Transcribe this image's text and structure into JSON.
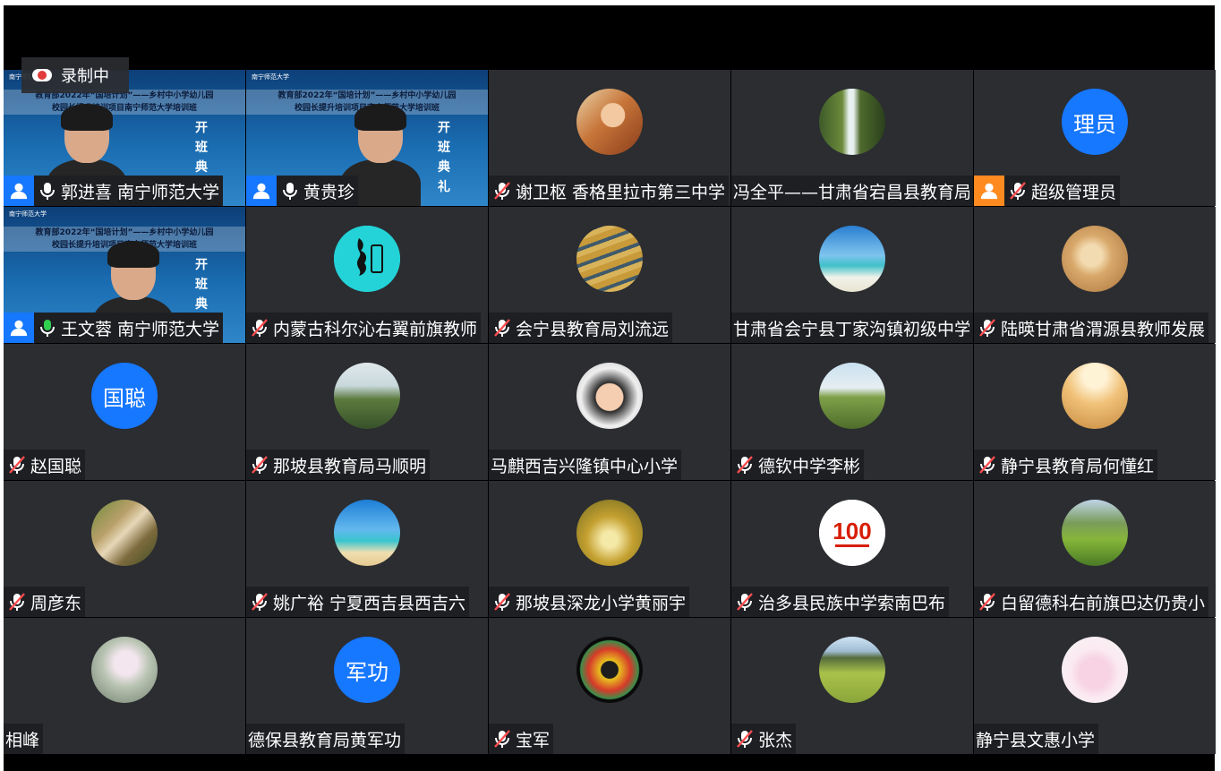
{
  "recording": {
    "label": "录制中"
  },
  "colors": {
    "tile_bg": "#2b2d31",
    "badge_blue": "#1677ff",
    "badge_orange": "#ff8a1f",
    "active_border": "#2fd14f"
  },
  "shared_screen": {
    "university": "南宁师范大学",
    "banner_line1": "教育部2022年“国培计划”——乡村中小学幼儿园",
    "banner_line2": "校园长提升培训项目南宁师范大学培训班",
    "side_text": "开班典礼"
  },
  "participants": [
    {
      "name": "郭进喜 南宁师范大学",
      "avatar_type": "video",
      "avatar_desc": "person-video",
      "badge": "blue",
      "mic": "on"
    },
    {
      "name": "黄贵珍",
      "avatar_type": "video",
      "avatar_desc": "person-video",
      "badge": "blue",
      "mic": "on"
    },
    {
      "name": "谢卫枢 香格里拉市第三中学",
      "avatar_type": "image",
      "avatar_desc": "illustrated-girl-avatar",
      "mic": "muted"
    },
    {
      "name": "冯全平——甘肃省宕昌县教育局",
      "avatar_type": "image",
      "avatar_desc": "waterfall-avatar",
      "mic": "none"
    },
    {
      "name": "超级管理员",
      "avatar_type": "text",
      "avatar_text": "理员",
      "badge": "orange",
      "mic": "muted"
    },
    {
      "name": "王文蓉 南宁师范大学",
      "avatar_type": "video",
      "avatar_desc": "person-video",
      "badge": "blue",
      "mic": "speaking",
      "active": true
    },
    {
      "name": "内蒙古科尔沁右翼前旗教师",
      "avatar_type": "image",
      "avatar_desc": "mongolia-logo-avatar",
      "mic": "muted"
    },
    {
      "name": "会宁县教育局刘流远",
      "avatar_type": "image",
      "avatar_desc": "terraced-fields-avatar",
      "mic": "muted"
    },
    {
      "name": "甘肃省会宁县丁家沟镇初级中学",
      "avatar_type": "image",
      "avatar_desc": "beach-avatar",
      "mic": "none"
    },
    {
      "name": "陆暎甘肃省渭源县教师发展",
      "avatar_type": "image",
      "avatar_desc": "sketch-portrait-avatar",
      "mic": "muted"
    },
    {
      "name": "赵国聪",
      "avatar_type": "text",
      "avatar_text": "国聪",
      "mic": "muted"
    },
    {
      "name": "那坡县教育局马顺明",
      "avatar_type": "image",
      "avatar_desc": "mountain-village-avatar",
      "mic": "muted"
    },
    {
      "name": "马麒西吉兴隆镇中心小学",
      "avatar_type": "image",
      "avatar_desc": "baby-photo-avatar",
      "mic": "none"
    },
    {
      "name": "德钦中学李彬",
      "avatar_type": "image",
      "avatar_desc": "grassland-avatar",
      "mic": "muted"
    },
    {
      "name": "静宁县教育局何懂红",
      "avatar_type": "image",
      "avatar_desc": "deer-avatar",
      "mic": "muted"
    },
    {
      "name": "周彦东",
      "avatar_type": "image",
      "avatar_desc": "stream-avatar",
      "mic": "muted"
    },
    {
      "name": "姚广裕  宁夏西吉县西吉六",
      "avatar_type": "image",
      "avatar_desc": "tropical-beach-avatar",
      "mic": "muted"
    },
    {
      "name": "那坡县深龙小学黄丽宇",
      "avatar_type": "image",
      "avatar_desc": "autumn-road-avatar",
      "mic": "muted"
    },
    {
      "name": "治多县民族中学索南巴布",
      "avatar_type": "image",
      "avatar_desc": "party-100-logo-avatar",
      "mic": "muted"
    },
    {
      "name": "白留德科右前旗巴达仍贵小",
      "avatar_type": "image",
      "avatar_desc": "meadow-avatar",
      "mic": "muted"
    },
    {
      "name": "相峰",
      "avatar_type": "image",
      "avatar_desc": "lotus-avatar",
      "mic": "none"
    },
    {
      "name": "德保县教育局黄军功",
      "avatar_type": "text",
      "avatar_text": "军功",
      "mic": "none"
    },
    {
      "name": "宝军",
      "avatar_type": "image",
      "avatar_desc": "flag-logo-avatar",
      "mic": "muted"
    },
    {
      "name": "张杰",
      "avatar_type": "image",
      "avatar_desc": "rice-field-avatar",
      "mic": "muted"
    },
    {
      "name": "静宁县文惠小学",
      "avatar_type": "image",
      "avatar_desc": "cartoon-snail-avatar",
      "mic": "none"
    }
  ]
}
